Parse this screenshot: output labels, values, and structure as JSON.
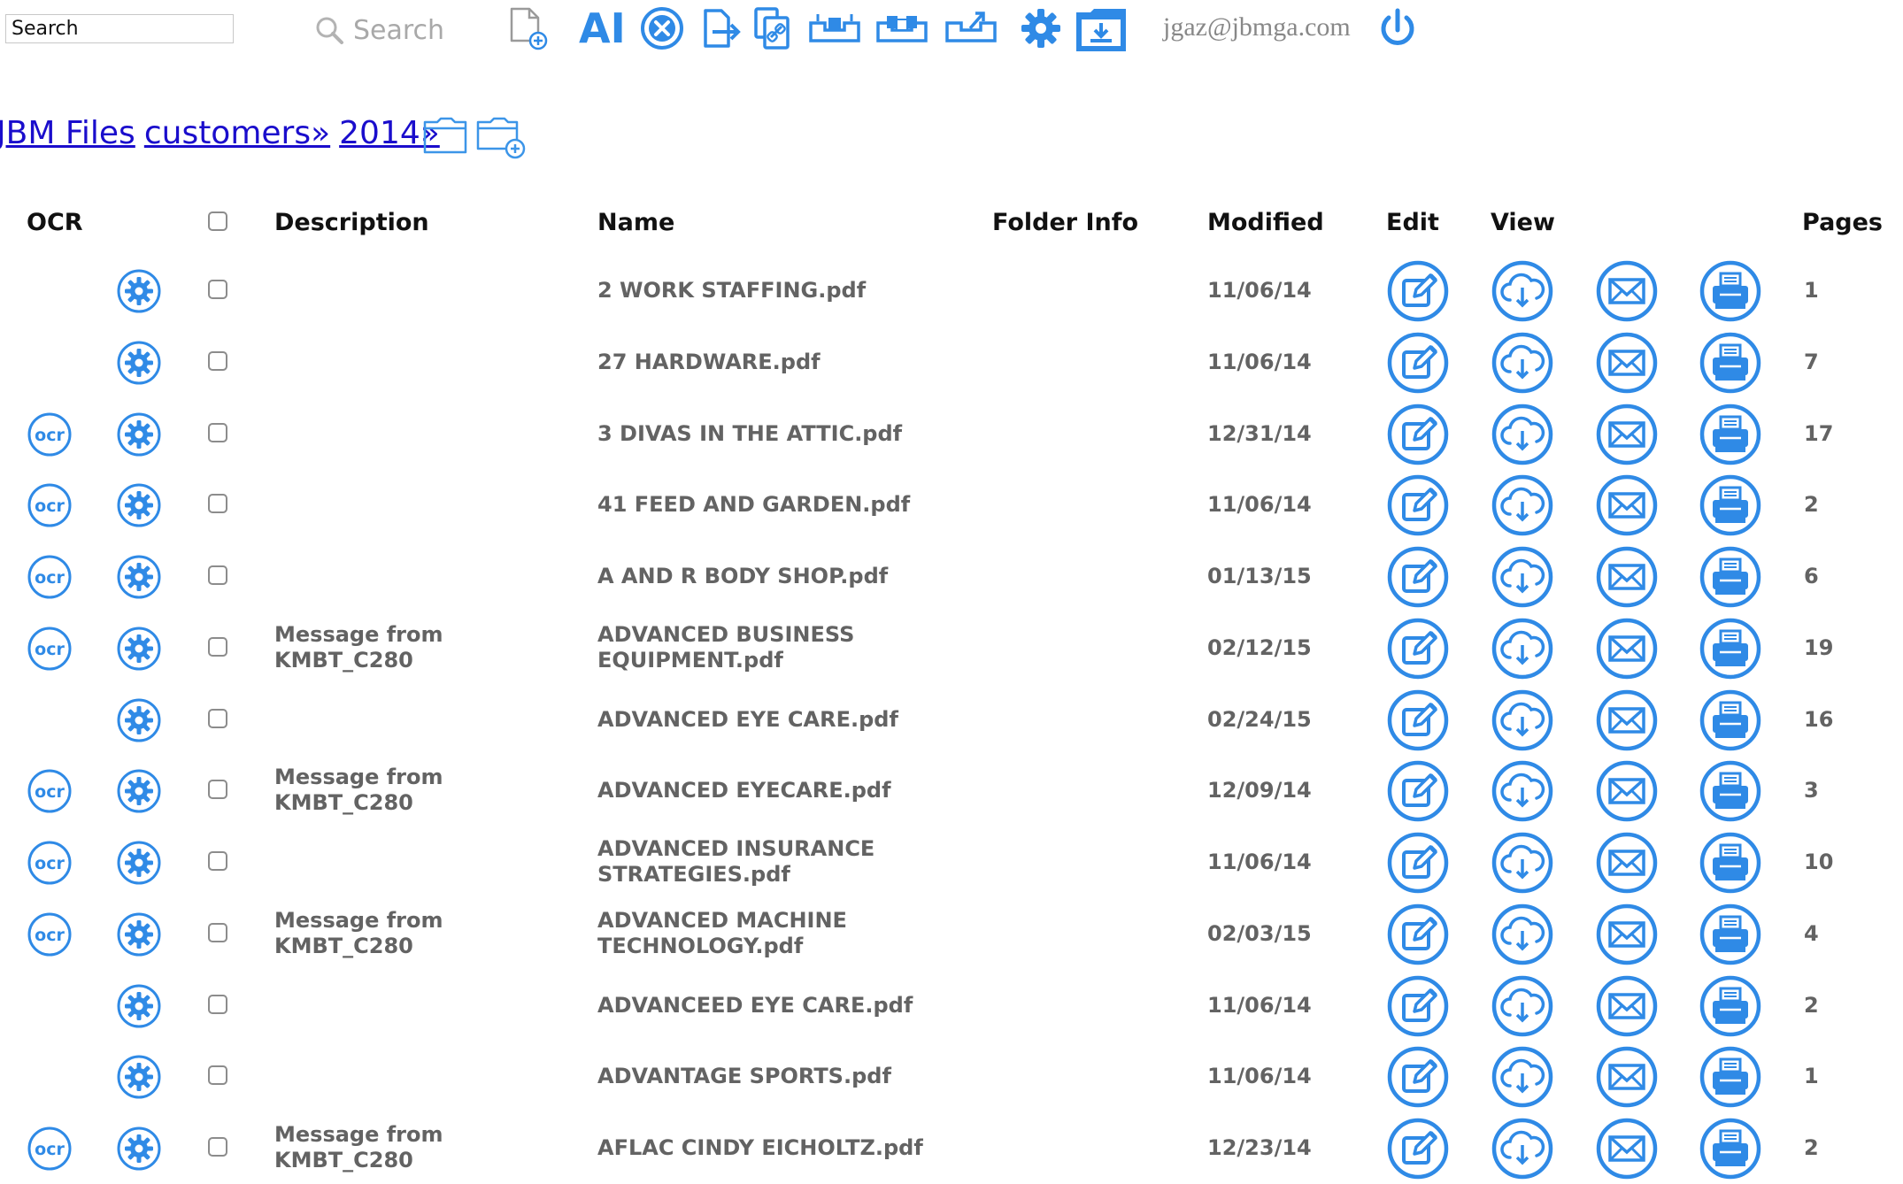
{
  "toolbar": {
    "search_field_value": "Search",
    "search_button_label": "Search",
    "user_email": "jgaz@jbmga.com",
    "icons": [
      "new-document-icon",
      "ai-icon",
      "cancel-icon",
      "export-icon",
      "link-document-icon",
      "tray-icon",
      "tray-multi-icon",
      "tray-out-icon",
      "gear-icon",
      "download-icon",
      "power-icon"
    ],
    "ai_label": "AI",
    "accent_color": "#2f8ae6"
  },
  "breadcrumb": {
    "items": [
      "JBM Files",
      "customers»",
      "2014»"
    ],
    "icons": [
      "folder-icon",
      "new-folder-icon"
    ]
  },
  "table": {
    "headers": {
      "ocr": "OCR",
      "description": "Description",
      "name": "Name",
      "folder_info": "Folder Info",
      "modified": "Modified",
      "edit": "Edit",
      "view": "View",
      "pages": "Pages"
    },
    "ocr_badge_label": "ocr",
    "rows": [
      {
        "ocr": false,
        "description": "",
        "name": "2 WORK STAFFING.pdf",
        "modified": "11/06/14",
        "pages": "1"
      },
      {
        "ocr": false,
        "description": "",
        "name": "27 HARDWARE.pdf",
        "modified": "11/06/14",
        "pages": "7"
      },
      {
        "ocr": true,
        "description": "",
        "name": "3 DIVAS IN THE ATTIC.pdf",
        "modified": "12/31/14",
        "pages": "17"
      },
      {
        "ocr": true,
        "description": "",
        "name": "41 FEED AND GARDEN.pdf",
        "modified": "11/06/14",
        "pages": "2"
      },
      {
        "ocr": true,
        "description": "",
        "name": "A AND R BODY SHOP.pdf",
        "modified": "01/13/15",
        "pages": "6"
      },
      {
        "ocr": true,
        "description": "Message from\nKMBT_C280",
        "name": "ADVANCED BUSINESS\nEQUIPMENT.pdf",
        "modified": "02/12/15",
        "pages": "19"
      },
      {
        "ocr": false,
        "description": "",
        "name": "ADVANCED EYE CARE.pdf",
        "modified": "02/24/15",
        "pages": "16"
      },
      {
        "ocr": true,
        "description": "Message from\nKMBT_C280",
        "name": "ADVANCED EYECARE.pdf",
        "modified": "12/09/14",
        "pages": "3"
      },
      {
        "ocr": true,
        "description": "",
        "name": "ADVANCED INSURANCE\nSTRATEGIES.pdf",
        "modified": "11/06/14",
        "pages": "10"
      },
      {
        "ocr": true,
        "description": "Message from\nKMBT_C280",
        "name": "ADVANCED MACHINE\nTECHNOLOGY.pdf",
        "modified": "02/03/15",
        "pages": "4"
      },
      {
        "ocr": false,
        "description": "",
        "name": "ADVANCEED EYE CARE.pdf",
        "modified": "11/06/14",
        "pages": "2"
      },
      {
        "ocr": false,
        "description": "",
        "name": "ADVANTAGE SPORTS.pdf",
        "modified": "11/06/14",
        "pages": "1"
      },
      {
        "ocr": true,
        "description": "Message from\nKMBT_C280",
        "name": "AFLAC CINDY EICHOLTZ.pdf",
        "modified": "12/23/14",
        "pages": "2"
      }
    ]
  }
}
